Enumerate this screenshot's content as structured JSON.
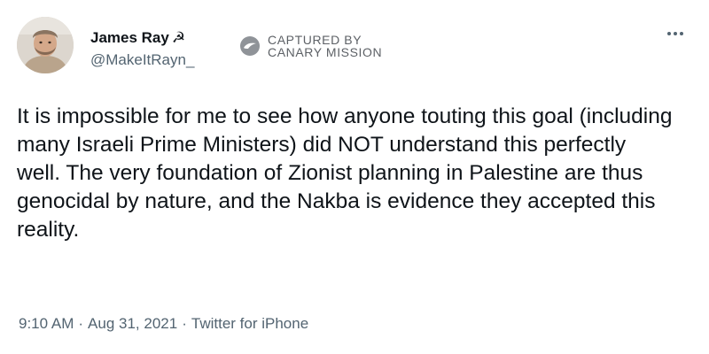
{
  "author": {
    "display_name": "James Ray",
    "name_emoji": "☭",
    "handle": "@MakeItRayn_"
  },
  "watermark": {
    "line1": "CAPTURED BY",
    "line2": "CANARY MISSION"
  },
  "tweet": {
    "text": "It is impossible for me to see how anyone touting this goal (including many Israeli Prime Ministers) did NOT understand this perfectly well. The very foundation of Zionist planning in Palestine are thus genocidal by nature, and the Nakba is evidence they accepted this reality."
  },
  "meta": {
    "time": "9:10 AM",
    "separator": "·",
    "date": "Aug 31, 2021",
    "source": "Twitter for iPhone"
  },
  "icons": {
    "more": "more-icon",
    "watermark_logo": "canary-logo-icon"
  },
  "colors": {
    "primary_text": "#0f1419",
    "secondary_text": "#536471",
    "watermark": "#5d6166"
  }
}
